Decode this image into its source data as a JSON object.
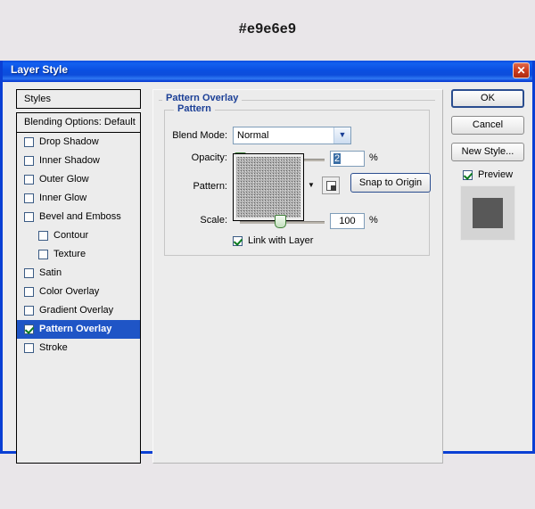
{
  "page": {
    "hex_label": "#e9e6e9",
    "background_color": "#e9e6e9"
  },
  "dialog": {
    "title": "Layer Style",
    "close_icon": "close-icon",
    "titlebar_color": "#0a50e2",
    "accent_color": "#1b3f96"
  },
  "styles_panel": {
    "header": "Styles",
    "blending_options": "Blending Options: Default",
    "items": [
      {
        "label": "Drop Shadow",
        "checked": false,
        "sub": false,
        "selected": false
      },
      {
        "label": "Inner Shadow",
        "checked": false,
        "sub": false,
        "selected": false
      },
      {
        "label": "Outer Glow",
        "checked": false,
        "sub": false,
        "selected": false
      },
      {
        "label": "Inner Glow",
        "checked": false,
        "sub": false,
        "selected": false
      },
      {
        "label": "Bevel and Emboss",
        "checked": false,
        "sub": false,
        "selected": false
      },
      {
        "label": "Contour",
        "checked": false,
        "sub": true,
        "selected": false
      },
      {
        "label": "Texture",
        "checked": false,
        "sub": true,
        "selected": false
      },
      {
        "label": "Satin",
        "checked": false,
        "sub": false,
        "selected": false
      },
      {
        "label": "Color Overlay",
        "checked": false,
        "sub": false,
        "selected": false
      },
      {
        "label": "Gradient Overlay",
        "checked": false,
        "sub": false,
        "selected": false
      },
      {
        "label": "Pattern Overlay",
        "checked": true,
        "sub": false,
        "selected": true
      },
      {
        "label": "Stroke",
        "checked": false,
        "sub": false,
        "selected": false
      }
    ]
  },
  "main_panel": {
    "section_title": "Pattern Overlay",
    "group_title": "Pattern",
    "blend_mode": {
      "label": "Blend Mode:",
      "value": "Normal",
      "arrow_icon": "chevron-down-icon"
    },
    "opacity": {
      "label": "Opacity:",
      "value": "2",
      "unit": "%",
      "slider_percent": 2
    },
    "pattern": {
      "label": "Pattern:",
      "swatch_name": "pattern-swatch",
      "dropdown_icon": "chevron-down-icon",
      "new_preset_icon": "new-preset-icon",
      "snap_button": "Snap to Origin"
    },
    "scale": {
      "label": "Scale:",
      "value": "100",
      "unit": "%",
      "slider_percent": 50
    },
    "link_with_layer": {
      "label": "Link with Layer",
      "checked": true
    }
  },
  "right_buttons": {
    "ok": "OK",
    "cancel": "Cancel",
    "new_style": "New Style...",
    "preview": {
      "label": "Preview",
      "checked": true
    },
    "thumb_bg": "#d4d4d4",
    "thumb_square": "#585858"
  }
}
